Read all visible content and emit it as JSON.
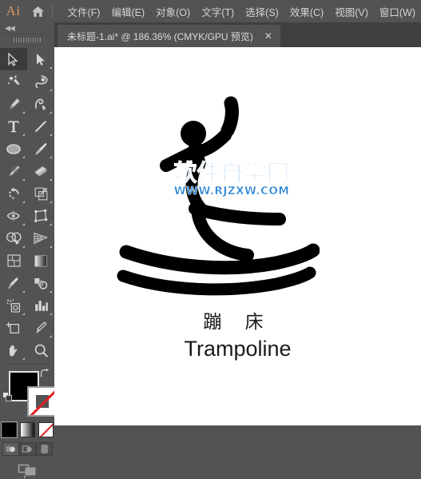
{
  "app": {
    "logo_text": "Ai",
    "home_icon": "home-icon"
  },
  "menubar": {
    "items": [
      {
        "label": "文件(F)"
      },
      {
        "label": "编辑(E)"
      },
      {
        "label": "对象(O)"
      },
      {
        "label": "文字(T)"
      },
      {
        "label": "选择(S)"
      },
      {
        "label": "效果(C)"
      },
      {
        "label": "视图(V)"
      },
      {
        "label": "窗口(W)"
      }
    ]
  },
  "document_tab": {
    "title": "未标题-1.ai* @ 186.36% (CMYK/GPU 预览)",
    "close_label": "✕",
    "zoom": "186.36%",
    "color_mode": "CMYK/GPU 预览",
    "file_name": "未标题-1.ai*"
  },
  "toolbar": {
    "collapse_label": "◀◀",
    "tools": [
      {
        "name": "selection-tool",
        "selected": true,
        "has_flyout": false
      },
      {
        "name": "direct-selection-tool",
        "selected": false,
        "has_flyout": true
      },
      {
        "name": "magic-wand-tool",
        "selected": false,
        "has_flyout": false
      },
      {
        "name": "lasso-tool",
        "selected": false,
        "has_flyout": false
      },
      {
        "name": "pen-tool",
        "selected": false,
        "has_flyout": true
      },
      {
        "name": "curvature-tool",
        "selected": false,
        "has_flyout": false
      },
      {
        "name": "type-tool",
        "selected": false,
        "has_flyout": true
      },
      {
        "name": "line-segment-tool",
        "selected": false,
        "has_flyout": true
      },
      {
        "name": "ellipse-tool",
        "selected": false,
        "has_flyout": true
      },
      {
        "name": "paintbrush-tool",
        "selected": false,
        "has_flyout": true
      },
      {
        "name": "blob-brush-tool",
        "selected": false,
        "has_flyout": true
      },
      {
        "name": "eraser-tool",
        "selected": false,
        "has_flyout": true
      },
      {
        "name": "rotate-tool",
        "selected": false,
        "has_flyout": true
      },
      {
        "name": "scale-tool",
        "selected": false,
        "has_flyout": true
      },
      {
        "name": "width-tool",
        "selected": false,
        "has_flyout": true
      },
      {
        "name": "free-transform-tool",
        "selected": false,
        "has_flyout": true
      },
      {
        "name": "shape-builder-tool",
        "selected": false,
        "has_flyout": true
      },
      {
        "name": "perspective-grid-tool",
        "selected": false,
        "has_flyout": true
      },
      {
        "name": "mesh-tool",
        "selected": false,
        "has_flyout": false
      },
      {
        "name": "gradient-tool",
        "selected": false,
        "has_flyout": false
      },
      {
        "name": "eyedropper-tool",
        "selected": false,
        "has_flyout": true
      },
      {
        "name": "blend-tool",
        "selected": false,
        "has_flyout": false
      },
      {
        "name": "symbol-sprayer-tool",
        "selected": false,
        "has_flyout": true
      },
      {
        "name": "column-graph-tool",
        "selected": false,
        "has_flyout": true
      },
      {
        "name": "artboard-tool",
        "selected": false,
        "has_flyout": false
      },
      {
        "name": "slice-tool",
        "selected": false,
        "has_flyout": true
      },
      {
        "name": "hand-tool",
        "selected": false,
        "has_flyout": true
      },
      {
        "name": "zoom-tool",
        "selected": false,
        "has_flyout": false
      }
    ],
    "color_controls": {
      "fill_color": "#000000",
      "fill_label": "填色",
      "stroke_color": "none",
      "stroke_label": "描边",
      "swap_label": "互换填色和描边",
      "default_label": "默认填色和描边",
      "modes": [
        {
          "name": "color-mode-solid",
          "label": "颜色",
          "active": true
        },
        {
          "name": "color-mode-gradient",
          "label": "渐变",
          "active": false
        },
        {
          "name": "color-mode-none",
          "label": "无",
          "active": false
        }
      ],
      "draw_modes": [
        {
          "name": "draw-normal",
          "label": "正常绘图",
          "active": true
        },
        {
          "name": "draw-behind",
          "label": "背面绘图",
          "active": false
        },
        {
          "name": "draw-inside",
          "label": "内部绘图",
          "active": false
        }
      ],
      "screen_mode_label": "更改屏幕模式"
    }
  },
  "canvas": {
    "watermark": {
      "cn_text": "软件自学网",
      "url_text": "WWW.RJZXW.COM",
      "color": "#1b7fd4"
    },
    "artwork": {
      "name": "trampoline-illustration",
      "stroke_color": "#000000"
    },
    "caption": {
      "cn": "蹦 床",
      "en": "Trampoline"
    }
  },
  "colors": {
    "chrome": "#535353",
    "tabbar": "#3f3f3f",
    "canvas": "#ffffff",
    "menu_text": "#d4d4d4",
    "accent": "#d79b6a"
  }
}
